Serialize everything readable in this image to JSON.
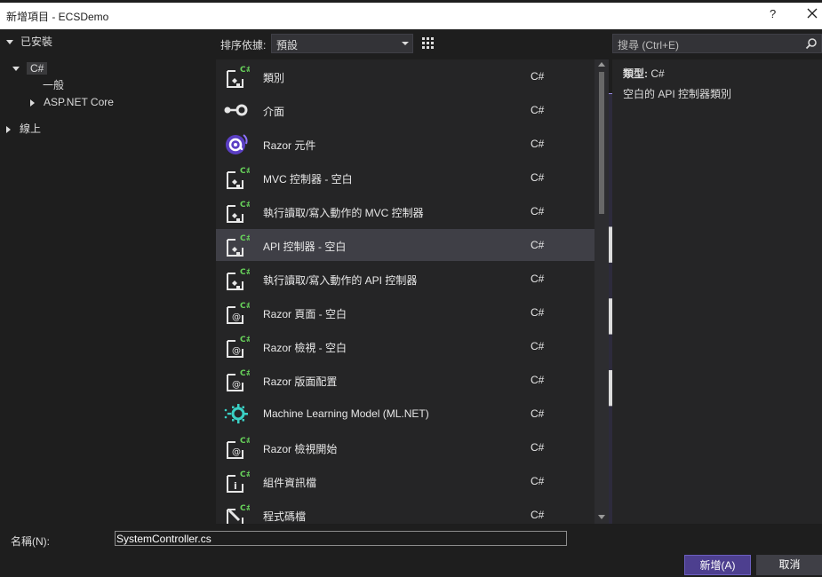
{
  "window": {
    "title": "新增項目 - ECSDemo",
    "help": "?",
    "close_icon": "close-icon"
  },
  "tree": {
    "installed": "已安裝",
    "csharp": "C#",
    "general": "一般",
    "aspnet": "ASP.NET Core",
    "online": "線上"
  },
  "sort": {
    "label": "排序依據:",
    "value": "預設"
  },
  "search": {
    "placeholder": "搜尋 (Ctrl+E)"
  },
  "templates": [
    {
      "name": "類別",
      "lang": "C#",
      "icon": "csharp-class-icon"
    },
    {
      "name": "介面",
      "lang": "C#",
      "icon": "interface-icon"
    },
    {
      "name": "Razor 元件",
      "lang": "C#",
      "icon": "razor-component-icon"
    },
    {
      "name": "MVC 控制器 - 空白",
      "lang": "C#",
      "icon": "csharp-class-icon"
    },
    {
      "name": "執行讀取/寫入動作的 MVC 控制器",
      "lang": "C#",
      "icon": "csharp-class-icon"
    },
    {
      "name": "API 控制器 - 空白",
      "lang": "C#",
      "icon": "csharp-class-icon",
      "selected": true
    },
    {
      "name": "執行讀取/寫入動作的 API 控制器",
      "lang": "C#",
      "icon": "csharp-class-icon"
    },
    {
      "name": "Razor 頁面 - 空白",
      "lang": "C#",
      "icon": "razor-page-icon"
    },
    {
      "name": "Razor 檢視 - 空白",
      "lang": "C#",
      "icon": "razor-page-icon"
    },
    {
      "name": "Razor 版面配置",
      "lang": "C#",
      "icon": "razor-page-icon"
    },
    {
      "name": "Machine Learning Model (ML.NET)",
      "lang": "C#",
      "icon": "ml-net-icon"
    },
    {
      "name": "Razor 檢視開始",
      "lang": "C#",
      "icon": "razor-page-icon"
    },
    {
      "name": "組件資訊檔",
      "lang": "C#",
      "icon": "assembly-info-icon"
    },
    {
      "name": "程式碼檔",
      "lang": "C#",
      "icon": "code-file-icon"
    }
  ],
  "detail": {
    "type_label": "類型:",
    "type_value": "C#",
    "description": "空白的 API 控制器類別"
  },
  "form": {
    "name_label": "名稱(N):",
    "name_value": "SystemController.cs"
  },
  "buttons": {
    "add": "新增(A)",
    "cancel": "取消"
  },
  "colors": {
    "accent": "#4d3f8f",
    "csharp_green": "#68d35b",
    "razor_purple": "#7b5cf0",
    "ml_teal": "#3ad0c4"
  }
}
